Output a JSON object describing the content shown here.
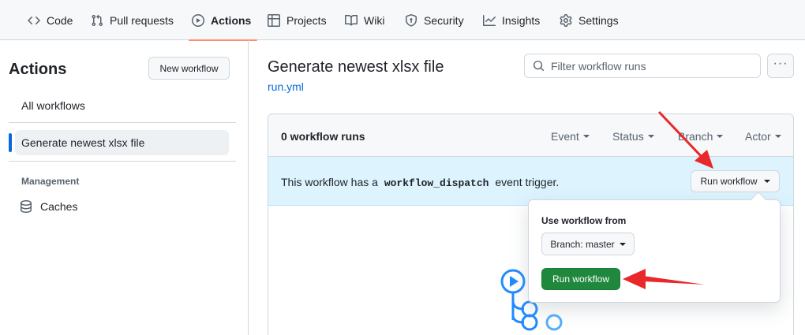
{
  "repo_nav": {
    "items": [
      {
        "label": "Code",
        "icon": "code-icon"
      },
      {
        "label": "Pull requests",
        "icon": "pull-request-icon"
      },
      {
        "label": "Actions",
        "icon": "play-icon",
        "active": true
      },
      {
        "label": "Projects",
        "icon": "table-icon"
      },
      {
        "label": "Wiki",
        "icon": "book-icon"
      },
      {
        "label": "Security",
        "icon": "shield-icon"
      },
      {
        "label": "Insights",
        "icon": "graph-icon"
      },
      {
        "label": "Settings",
        "icon": "gear-icon"
      }
    ]
  },
  "sidebar": {
    "title": "Actions",
    "new_workflow_label": "New workflow",
    "all_workflows_label": "All workflows",
    "selected_workflow": "Generate newest xlsx file",
    "management_heading": "Management",
    "caches_label": "Caches"
  },
  "main": {
    "workflow_title": "Generate newest xlsx file",
    "workflow_file": "run.yml",
    "filter_placeholder": "Filter workflow runs",
    "runs_count": "0 workflow runs",
    "filters": [
      "Event",
      "Status",
      "Branch",
      "Actor"
    ],
    "dispatch_prefix": "This workflow has a",
    "dispatch_code": "workflow_dispatch",
    "dispatch_suffix": "event trigger.",
    "run_workflow_label": "Run workflow"
  },
  "popover": {
    "use_from_label": "Use workflow from",
    "branch_label": "Branch: master",
    "run_button_label": "Run workflow"
  },
  "colors": {
    "accent_blue": "#0969da",
    "active_underline": "#fd8c73",
    "run_green": "#1f883d",
    "dispatch_bg": "#ddf4ff",
    "annotation_red": "#e8282b"
  }
}
